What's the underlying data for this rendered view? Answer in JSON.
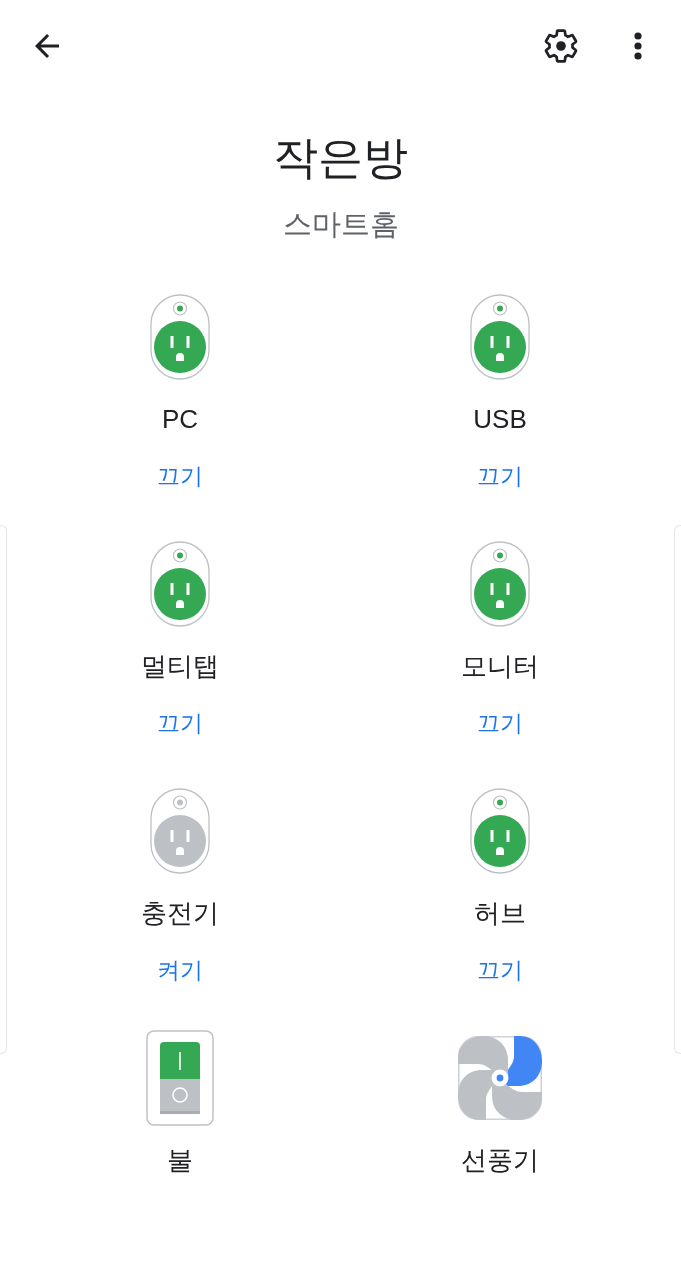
{
  "room": {
    "title": "작은방",
    "subtitle": "스마트홈"
  },
  "devices": [
    {
      "kind": "outlet",
      "name": "PC",
      "on": true,
      "action": "끄기"
    },
    {
      "kind": "outlet",
      "name": "USB",
      "on": true,
      "action": "끄기"
    },
    {
      "kind": "outlet",
      "name": "멀티탭",
      "on": true,
      "action": "끄기"
    },
    {
      "kind": "outlet",
      "name": "모니터",
      "on": true,
      "action": "끄기"
    },
    {
      "kind": "outlet",
      "name": "충전기",
      "on": false,
      "action": "켜기"
    },
    {
      "kind": "outlet",
      "name": "허브",
      "on": true,
      "action": "끄기"
    },
    {
      "kind": "switch",
      "name": "불"
    },
    {
      "kind": "fan",
      "name": "선풍기"
    }
  ]
}
